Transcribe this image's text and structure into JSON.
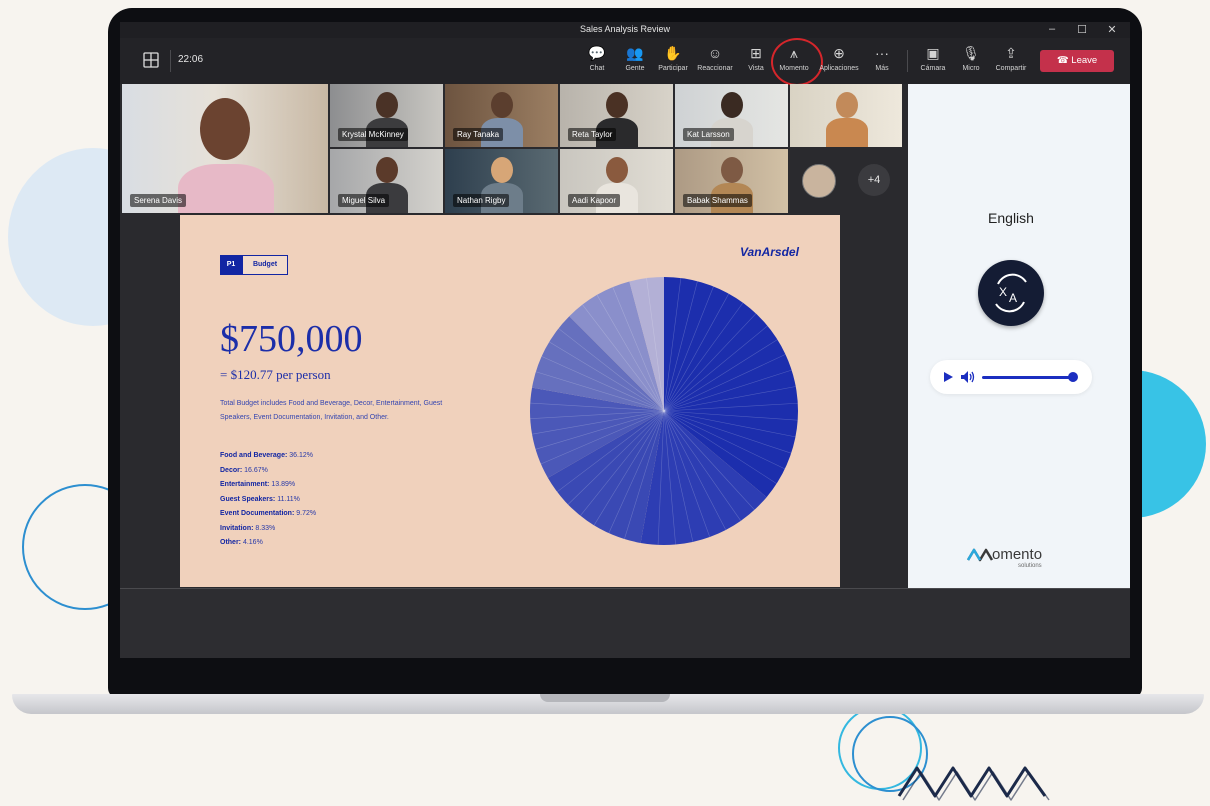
{
  "window": {
    "title": "Sales Analysis Review",
    "minimize": "–",
    "maximize": "☐",
    "close": "✕"
  },
  "meeting": {
    "time": "22:06",
    "toolbar": [
      {
        "icon": "chat-icon",
        "glyph": "💬",
        "label": "Chat"
      },
      {
        "icon": "people-icon",
        "glyph": "👥",
        "label": "Gente"
      },
      {
        "icon": "raise-hand-icon",
        "glyph": "✋",
        "label": "Participar"
      },
      {
        "icon": "react-icon",
        "glyph": "☺",
        "label": "Reaccionar"
      },
      {
        "icon": "view-icon",
        "glyph": "⊞",
        "label": "Vista"
      },
      {
        "icon": "momento-icon",
        "glyph": "⩚",
        "label": "Momento"
      },
      {
        "icon": "apps-icon",
        "glyph": "⊕",
        "label": "Aplicaciones"
      },
      {
        "icon": "more-icon",
        "glyph": "···",
        "label": "Más"
      },
      {
        "icon": "camera-off-icon",
        "glyph": "▣",
        "label": "Cámara"
      },
      {
        "icon": "mic-icon",
        "glyph": "🎙",
        "label": "Micro"
      },
      {
        "icon": "share-icon",
        "glyph": "⇪",
        "label": "Compartir"
      }
    ],
    "leave_label": "Leave"
  },
  "participants": {
    "main": "Serena Davis",
    "tiles": [
      "Krystal McKinney",
      "Ray Tanaka",
      "Reta Taylor",
      "Kat Larsson",
      "",
      "Miguel Silva",
      "Nathan Rigby",
      "Aadi Kapoor",
      "Babak Shammas"
    ],
    "overflow": "+4"
  },
  "slide": {
    "tag_number": "P1",
    "tag_label": "Budget",
    "brand": "VanArsdel",
    "amount": "$750,000",
    "per_person": "= $120.77 per person",
    "description": "Total Budget includes Food and Beverage, Decor, Entertainment, Guest Speakers, Event Documentation, Invitation, and Other.",
    "breakdown": [
      {
        "label": "Food and Beverage:",
        "value": "36.12%"
      },
      {
        "label": "Decor:",
        "value": "16.67%"
      },
      {
        "label": "Entertainment:",
        "value": "13.89%"
      },
      {
        "label": "Guest Speakers:",
        "value": "11.11%"
      },
      {
        "label": "Event Documentation:",
        "value": "9.72%"
      },
      {
        "label": "Invitation:",
        "value": "8.33%"
      },
      {
        "label": "Other:",
        "value": "4.16%"
      }
    ]
  },
  "chart_data": {
    "type": "pie",
    "categories": [
      "Food and Beverage",
      "Decor",
      "Entertainment",
      "Guest Speakers",
      "Event Documentation",
      "Invitation",
      "Other"
    ],
    "values": [
      36.12,
      16.67,
      13.89,
      11.11,
      9.72,
      8.33,
      4.16
    ],
    "colors": [
      "#1c2ead",
      "#2d3db3",
      "#3a49b4",
      "#4b58b8",
      "#6670be",
      "#8a8fcb",
      "#b3b0d6"
    ]
  },
  "translator": {
    "language": "English",
    "logo_text": "omento",
    "logo_sub": "solutions"
  }
}
